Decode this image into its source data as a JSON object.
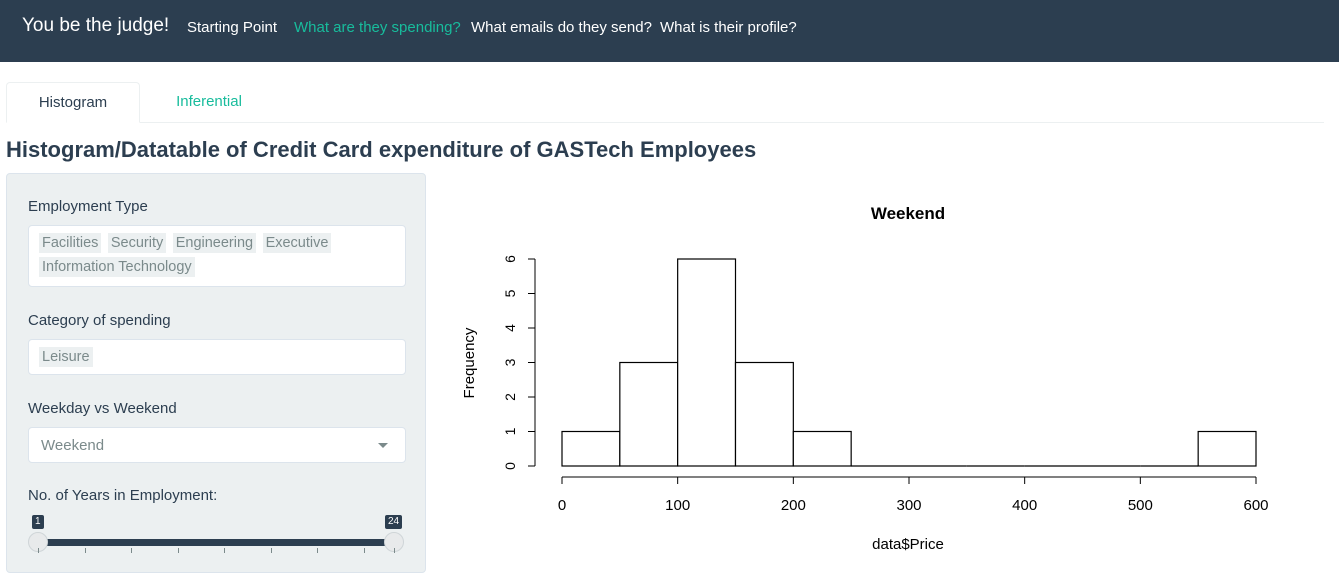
{
  "navbar": {
    "brand": "You be the judge!",
    "links": [
      {
        "label": "Starting Point",
        "active": false
      },
      {
        "label": "What are they spending?",
        "active": true
      },
      {
        "label": "What emails do they send?",
        "active": false
      },
      {
        "label": "What is their profile?",
        "active": false
      }
    ]
  },
  "tabs": [
    {
      "label": "Histogram",
      "active": true
    },
    {
      "label": "Inferential",
      "active": false
    }
  ],
  "page_title": "Histogram/Datatable of Credit Card expenditure of GASTech Employees",
  "sidebar": {
    "employment_type": {
      "label": "Employment Type",
      "selected": [
        "Facilities",
        "Security",
        "Engineering",
        "Executive",
        "Information Technology"
      ]
    },
    "category": {
      "label": "Category of spending",
      "selected": [
        "Leisure"
      ]
    },
    "day_type": {
      "label": "Weekday vs Weekend",
      "value": "Weekend"
    },
    "years": {
      "label": "No. of Years in Employment:",
      "min_value": "1",
      "max_value": "24"
    }
  },
  "colors": {
    "navbar": "#2c3e50",
    "accent": "#18bc9c",
    "sidebar_bg": "#ecf0f1"
  },
  "icons": {
    "dropdown": "caret-down-icon"
  },
  "chart_data": {
    "type": "bar",
    "title": "Weekend",
    "xlabel": "data$Price",
    "ylabel": "Frequency",
    "bins": [
      {
        "from": 0,
        "to": 50,
        "count": 1
      },
      {
        "from": 50,
        "to": 100,
        "count": 3
      },
      {
        "from": 100,
        "to": 150,
        "count": 6
      },
      {
        "from": 150,
        "to": 200,
        "count": 3
      },
      {
        "from": 200,
        "to": 250,
        "count": 1
      },
      {
        "from": 250,
        "to": 300,
        "count": 0
      },
      {
        "from": 300,
        "to": 350,
        "count": 0
      },
      {
        "from": 350,
        "to": 400,
        "count": 0
      },
      {
        "from": 400,
        "to": 450,
        "count": 0
      },
      {
        "from": 450,
        "to": 500,
        "count": 0
      },
      {
        "from": 500,
        "to": 550,
        "count": 0
      },
      {
        "from": 550,
        "to": 600,
        "count": 1
      }
    ],
    "xlim": [
      0,
      600
    ],
    "ylim": [
      0,
      6
    ],
    "x_ticks": [
      0,
      100,
      200,
      300,
      400,
      500,
      600
    ],
    "y_ticks": [
      0,
      1,
      2,
      3,
      4,
      5,
      6
    ],
    "grid": false
  }
}
